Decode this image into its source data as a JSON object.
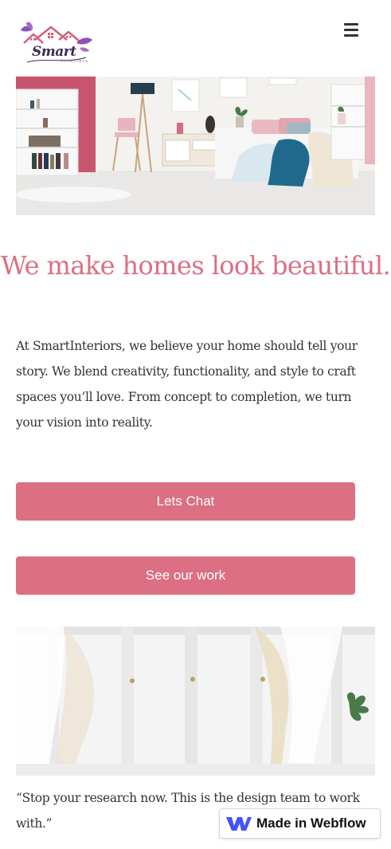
{
  "brand": {
    "name": "Smart",
    "tagline": "Interiors"
  },
  "header": {
    "menu_icon": "hamburger-icon"
  },
  "hero": {
    "image_icon": "bedroom-photo"
  },
  "main": {
    "headline": "We make homes look beautiful.",
    "intro": "At SmartInteriors, we believe your home should tell your story. We blend creativity, functionality, and style to craft spaces you’ll love. From concept to completion, we turn your vision into reality."
  },
  "actions": {
    "chat_label": "Lets Chat",
    "work_label": "See our work"
  },
  "gallery": {
    "image_icon": "window-curtains-photo"
  },
  "testimonial": {
    "quote": "“Stop your research now. This is the design team to work with.”"
  },
  "badge": {
    "label": "Made in Webflow",
    "icon": "webflow-logo-icon"
  },
  "colors": {
    "accent": "#dc6f82",
    "text": "#333333",
    "logo_purple": "#8e4fb8",
    "webflow_blue": "#4353ff"
  }
}
